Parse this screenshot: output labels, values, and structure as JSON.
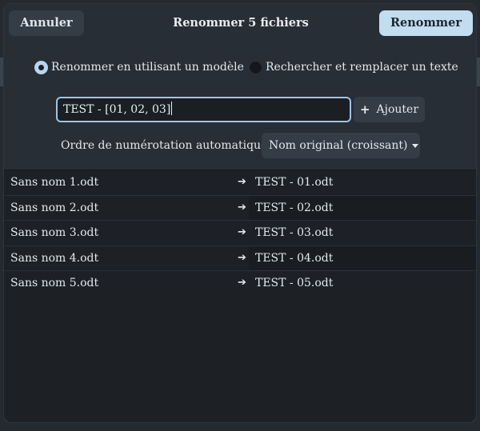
{
  "header": {
    "cancel_label": "Annuler",
    "title": "Renommer 5 fichiers",
    "rename_label": "Renommer"
  },
  "mode": {
    "option_template": "Renommer en utilisant un modèle",
    "option_search": "Rechercher et remplacer un texte",
    "selected": "template"
  },
  "pattern": {
    "value": "TEST - [01, 02, 03]",
    "add_label": "Ajouter"
  },
  "order": {
    "label": "Ordre de numérotation automatique",
    "selected": "Nom original (croissant)"
  },
  "files": [
    {
      "original": "Sans nom 1.odt",
      "renamed": "TEST - 01.odt"
    },
    {
      "original": "Sans nom 2.odt",
      "renamed": "TEST - 02.odt"
    },
    {
      "original": "Sans nom 3.odt",
      "renamed": "TEST - 03.odt"
    },
    {
      "original": "Sans nom 4.odt",
      "renamed": "TEST - 04.odt"
    },
    {
      "original": "Sans nom 5.odt",
      "renamed": "TEST - 05.odt"
    }
  ],
  "colors": {
    "accent": "#c2dcf0",
    "focus_border": "#9fc4e4",
    "background": "#1d2126"
  },
  "icons": {
    "add": "plus-icon",
    "dropdown": "chevron-down-icon",
    "row_arrow": "arrow-right-icon"
  }
}
